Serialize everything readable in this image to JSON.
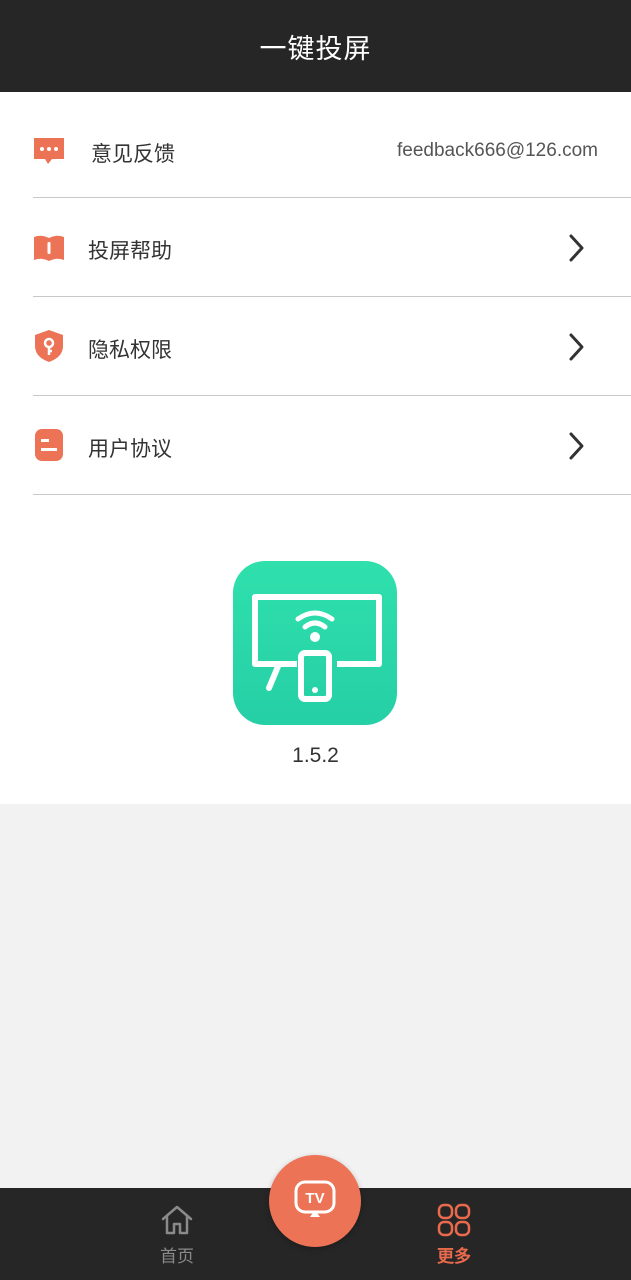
{
  "header": {
    "title": "一键投屏"
  },
  "menu": {
    "feedback": {
      "label": "意见反馈",
      "value": "feedback666@126.com",
      "icon": "chat-bubble-icon"
    },
    "help": {
      "label": "投屏帮助",
      "icon": "book-icon"
    },
    "privacy": {
      "label": "隐私权限",
      "icon": "shield-key-icon"
    },
    "agreement": {
      "label": "用户协议",
      "icon": "document-icon"
    }
  },
  "about": {
    "version": "1.5.2",
    "logo_icon": "screen-cast-app-icon"
  },
  "tabbar": {
    "home_label": "首页",
    "more_label": "更多",
    "center_icon": "tv-cast-icon"
  },
  "colors": {
    "accent": "#e96a4c",
    "header_bg": "#262626",
    "logo_green": "#2fd6a7"
  }
}
